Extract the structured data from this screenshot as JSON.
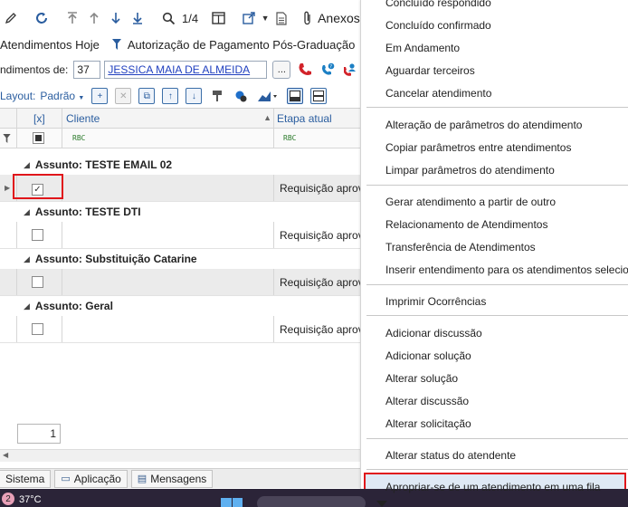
{
  "toolbar": {
    "page_indicator": "1/4",
    "anexos_label": "Anexos"
  },
  "tabs": {
    "atendimentos_hoje": "Atendimentos Hoje",
    "autorizacao": "Autorização de Pagamento Pós-Graduação"
  },
  "atendimento": {
    "label": "ndimentos de:",
    "code": "37",
    "name": "JESSICA MAIA DE ALMEIDA",
    "dots": "..."
  },
  "layout": {
    "label": "Layout:",
    "padrao": "Padrão"
  },
  "grid": {
    "headers": {
      "select": "[x]",
      "cliente": "Cliente",
      "etapa": "Etapa atual"
    },
    "filter_icon_text": "RBC",
    "groups": [
      {
        "label": "Assunto: TESTE EMAIL 02",
        "etapa": "Requisição aprova",
        "checked": true
      },
      {
        "label": "Assunto: TESTE DTI",
        "etapa": "Requisição aprova",
        "checked": false
      },
      {
        "label": "Assunto: Substituição Catarine",
        "etapa": "Requisição aprova",
        "checked": false
      },
      {
        "label": "Assunto: Geral",
        "etapa": "Requisição aprova",
        "checked": false
      }
    ],
    "page_box": "1"
  },
  "bottom_tabs": [
    "Sistema",
    "Aplicação",
    "Mensagens"
  ],
  "taskbar": {
    "badge": "2",
    "temperature": "37°C"
  },
  "menu": {
    "items": [
      "Concluído respondido",
      "Concluído confirmado",
      "Em Andamento",
      "Aguardar terceiros",
      "Cancelar atendimento",
      "Alteração de parâmetros do atendimento",
      "Copiar parâmetros entre atendimentos",
      "Limpar parâmetros do atendimento",
      "Gerar atendimento a partir de outro",
      "Relacionamento de Atendimentos",
      "Transferência de Atendimentos",
      "Inserir entendimento para os atendimentos selecionados",
      "Imprimir Ocorrências",
      "Adicionar discussão",
      "Adicionar solução",
      "Alterar solução",
      "Alterar discussão",
      "Alterar solicitação",
      "Alterar status do atendente",
      "Apropriar-se de um atendimento em uma fila"
    ]
  },
  "colors": {
    "accent": "#2a5d9f",
    "highlight_border": "#e0161b",
    "menu_highlight": "#dfe9f5"
  }
}
